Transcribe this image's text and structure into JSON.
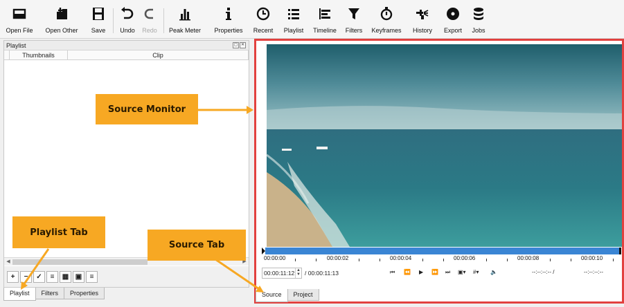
{
  "toolbar": {
    "buttons": [
      {
        "label": "Open File",
        "icon": "folder-icon"
      },
      {
        "label": "Open Other",
        "icon": "open-other-icon"
      },
      {
        "label": "Save",
        "icon": "save-icon"
      },
      {
        "label": "Undo",
        "icon": "undo-icon"
      },
      {
        "label": "Redo",
        "icon": "redo-icon",
        "disabled": true
      },
      {
        "label": "Peak Meter",
        "icon": "peak-meter-icon"
      },
      {
        "label": "Properties",
        "icon": "info-icon"
      },
      {
        "label": "Recent",
        "icon": "clock-icon"
      },
      {
        "label": "Playlist",
        "icon": "list-icon"
      },
      {
        "label": "Timeline",
        "icon": "timeline-icon"
      },
      {
        "label": "Filters",
        "icon": "funnel-icon"
      },
      {
        "label": "Keyframes",
        "icon": "stopwatch-icon"
      },
      {
        "label": "History",
        "icon": "history-icon"
      },
      {
        "label": "Export",
        "icon": "export-icon"
      },
      {
        "label": "Jobs",
        "icon": "jobs-icon"
      }
    ]
  },
  "playlist": {
    "title": "Playlist",
    "columns": {
      "thumbnails": "Thumbnails",
      "clip": "Clip"
    },
    "tools": [
      {
        "glyph": "+",
        "icon": "add-icon"
      },
      {
        "glyph": "−",
        "icon": "remove-icon"
      },
      {
        "glyph": "✓",
        "icon": "check-icon"
      },
      {
        "glyph": "≡",
        "icon": "details-view-icon"
      },
      {
        "glyph": "▦",
        "icon": "tiles-view-icon"
      },
      {
        "glyph": "▣",
        "icon": "icon-view-icon"
      },
      {
        "glyph": "≡",
        "icon": "menu-icon"
      }
    ]
  },
  "left_tabs": [
    "Playlist",
    "Filters",
    "Properties"
  ],
  "right_tabs": [
    "Source",
    "Project"
  ],
  "timeline": {
    "ticks": [
      "00:00:00",
      "00:00:02",
      "00:00:04",
      "00:00:06",
      "00:00:08",
      "00:00:10"
    ],
    "current_time": "00:00:11:12",
    "total_time": "/ 00:00:11:13",
    "in_point": "--:--:--:-- /",
    "out_point": "--:--:--:--"
  },
  "callouts": {
    "source_monitor": "Source Monitor",
    "playlist_tab": "Playlist Tab",
    "source_tab": "Source Tab"
  },
  "colors": {
    "callout": "#f7a823",
    "monitor_border": "#e2413f",
    "timeline_bar": "#3a85d4"
  }
}
